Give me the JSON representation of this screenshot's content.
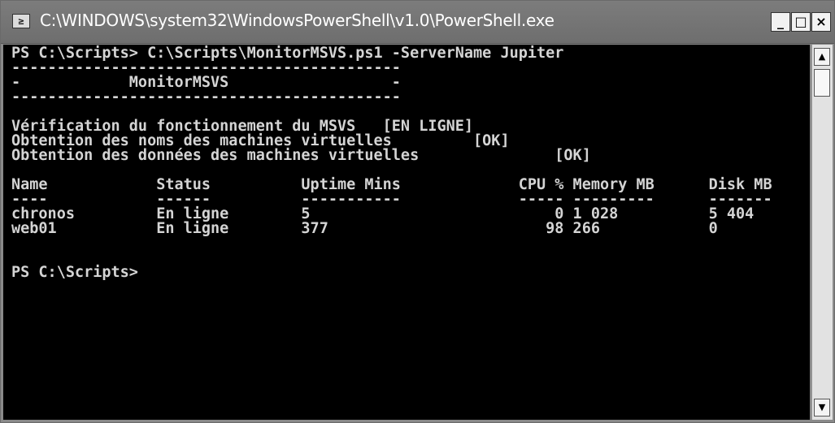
{
  "window": {
    "title": "C:\\WINDOWS\\system32\\WindowsPowerShell\\v1.0\\PowerShell.exe",
    "icon_glyph": "≥",
    "minimize_glyph": "_",
    "maximize_glyph": "□",
    "close_glyph": "×"
  },
  "console": {
    "lines": [
      "PS C:\\Scripts> C:\\Scripts\\MonitorMSVS.ps1 -ServerName Jupiter",
      "-------------------------------------------",
      "-            MonitorMSVS                  -",
      "-------------------------------------------",
      "",
      "Vérification du fonctionnement du MSVS   [EN LIGNE]",
      "Obtention des noms des machines virtuelles         [OK]",
      "Obtention des données des machines virtuelles               [OK]",
      "",
      "Name            Status          Uptime Mins             CPU % Memory MB      Disk MB",
      "----            ------          -----------             ----- ---------      -------",
      "chronos         En ligne        5                           0 1 028          5 404",
      "web01           En ligne        377                        98 266            0",
      "",
      "",
      "PS C:\\Scripts>"
    ]
  },
  "scrollbar": {
    "up_glyph": "▲",
    "down_glyph": "▼"
  }
}
